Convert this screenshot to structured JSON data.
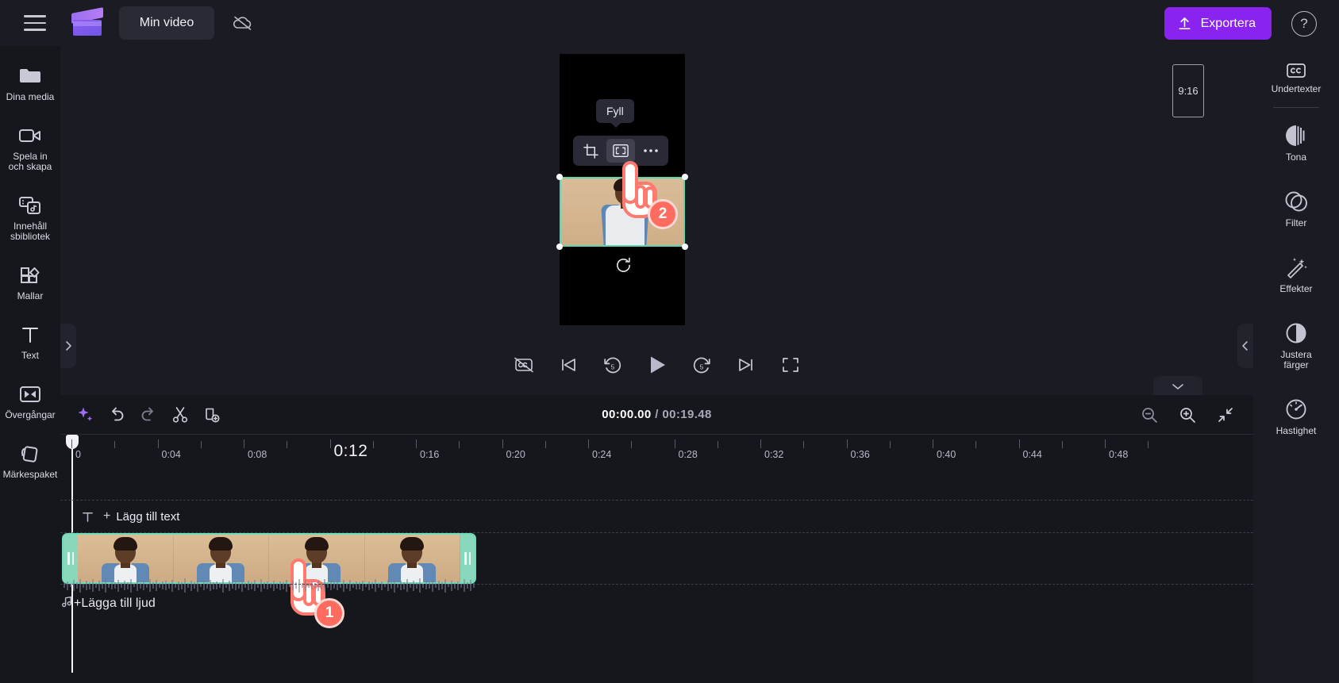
{
  "app": {
    "project_title": "Min video",
    "export_label": "Exportera",
    "help_label": "?"
  },
  "topbar": {
    "menu_icon": "hamburger-icon",
    "logo_icon": "clapperboard-icon",
    "cloud_icon": "cloud-off-icon",
    "upload_icon": "upload-arrow-icon"
  },
  "left_rail": {
    "items": [
      {
        "label": "Dina media",
        "icon": "folder-icon"
      },
      {
        "label": "Spela in\noch skapa",
        "icon": "video-camera-icon"
      },
      {
        "label": "Innehåll\nsbibliotek",
        "icon": "content-library-icon"
      },
      {
        "label": "Mallar",
        "icon": "templates-icon"
      },
      {
        "label": "Text",
        "icon": "text-t-icon"
      },
      {
        "label": "Övergångar",
        "icon": "transitions-icon"
      },
      {
        "label": "Märkespaket",
        "icon": "brand-kit-icon"
      }
    ]
  },
  "right_rail": {
    "items": [
      {
        "label": "Undertexter",
        "icon": "closed-caption-icon"
      },
      {
        "label": "Tona",
        "icon": "fade-icon"
      },
      {
        "label": "Filter",
        "icon": "filter-circles-icon"
      },
      {
        "label": "Effekter",
        "icon": "magic-wand-icon"
      },
      {
        "label": "Justera\nfärger",
        "icon": "adjust-colors-icon"
      },
      {
        "label": "Hastighet",
        "icon": "speed-gauge-icon"
      }
    ]
  },
  "stage": {
    "aspect_ratio": "9:16",
    "float_toolbar": {
      "crop_icon": "crop-icon",
      "fill_icon": "fill-expand-icon",
      "more_icon": "more-horizontal-icon",
      "tooltip": "Fyll"
    },
    "rotate_icon": "rotate-icon"
  },
  "playback": {
    "controls": [
      {
        "name": "captions-off-button",
        "icon": "cc-off-icon"
      },
      {
        "name": "skip-to-start-button",
        "icon": "skip-back-icon"
      },
      {
        "name": "rewind-5-button",
        "icon": "rewind-5-icon",
        "label": "5"
      },
      {
        "name": "play-button",
        "icon": "play-icon"
      },
      {
        "name": "forward-5-button",
        "icon": "forward-5-icon",
        "label": "5"
      },
      {
        "name": "skip-to-end-button",
        "icon": "skip-forward-icon"
      },
      {
        "name": "fullscreen-button",
        "icon": "fullscreen-icon"
      }
    ]
  },
  "timeline": {
    "toolbar": {
      "magic_icon": "sparkle-icon",
      "undo_icon": "undo-icon",
      "redo_icon": "redo-icon",
      "split_icon": "scissors-icon",
      "duplicate_icon": "duplicate-icon",
      "zoom_out_icon": "zoom-out-icon",
      "zoom_in_icon": "zoom-in-icon",
      "fit_icon": "fit-to-screen-icon"
    },
    "current_time": "00:00.00",
    "separator": "/",
    "total_time": "00:19.48",
    "ruler": {
      "labels": [
        "0",
        "0:04",
        "0:08",
        "0:12",
        "0:16",
        "0:20",
        "0:24",
        "0:28",
        "0:32",
        "0:36",
        "0:40",
        "0:44",
        "0:48"
      ],
      "highlighted_index": 3,
      "highlighted_label": "0:12"
    },
    "tracks": [
      {
        "name": "text-track",
        "icon": "text-t-icon",
        "plus": "+",
        "label": "Lägg till text"
      },
      {
        "name": "audio-track",
        "icon": "music-note-icon",
        "plus": "+",
        "label": "Lägga till ljud"
      }
    ],
    "video_clip": {
      "selected": true,
      "thumbnails": 4,
      "grip_icon": "trim-handle-icon"
    }
  },
  "annotations": [
    {
      "number": "1",
      "target": "video-clip-on-timeline"
    },
    {
      "number": "2",
      "target": "fill-button-on-preview"
    }
  ],
  "colors": {
    "accent_purple": "#8b23f0",
    "clip_green": "#6fdcb8",
    "cursor_red": "#ff6b5e",
    "panel_bg": "#1b1b23",
    "app_bg": "#16161d"
  }
}
